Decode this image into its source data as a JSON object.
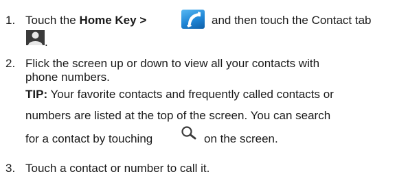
{
  "steps": [
    {
      "number": "1.",
      "line1_before": "Touch the ",
      "line1_bold": "Home Key >",
      "line1_after": "and then touch the Contact tab",
      "line2_after_icon": ".",
      "phone_icon": "phone-app-icon",
      "contact_icon": "contact-tab-icon"
    },
    {
      "number": "2.",
      "line1": "Flick the screen up or down to view all your contacts with",
      "line2": "phone numbers.",
      "tip_label": "TIP:",
      "tip_line1": " Your favorite contacts and frequently called contacts or",
      "tip_line2": "numbers are listed at the top of the screen. You can search",
      "tip_line3_before": "for a contact by touching",
      "tip_line3_after": "on the screen.",
      "search_icon": "search-icon"
    },
    {
      "number": "3.",
      "line1": "Touch a contact or number to call it."
    }
  ],
  "colors": {
    "text": "#1a1a1a",
    "phone_icon_light": "#58b8f2",
    "phone_icon_dark": "#0f5fa8",
    "contact_icon_bg": "#3a3a3a",
    "contact_icon_figure": "#e8e8e8"
  }
}
